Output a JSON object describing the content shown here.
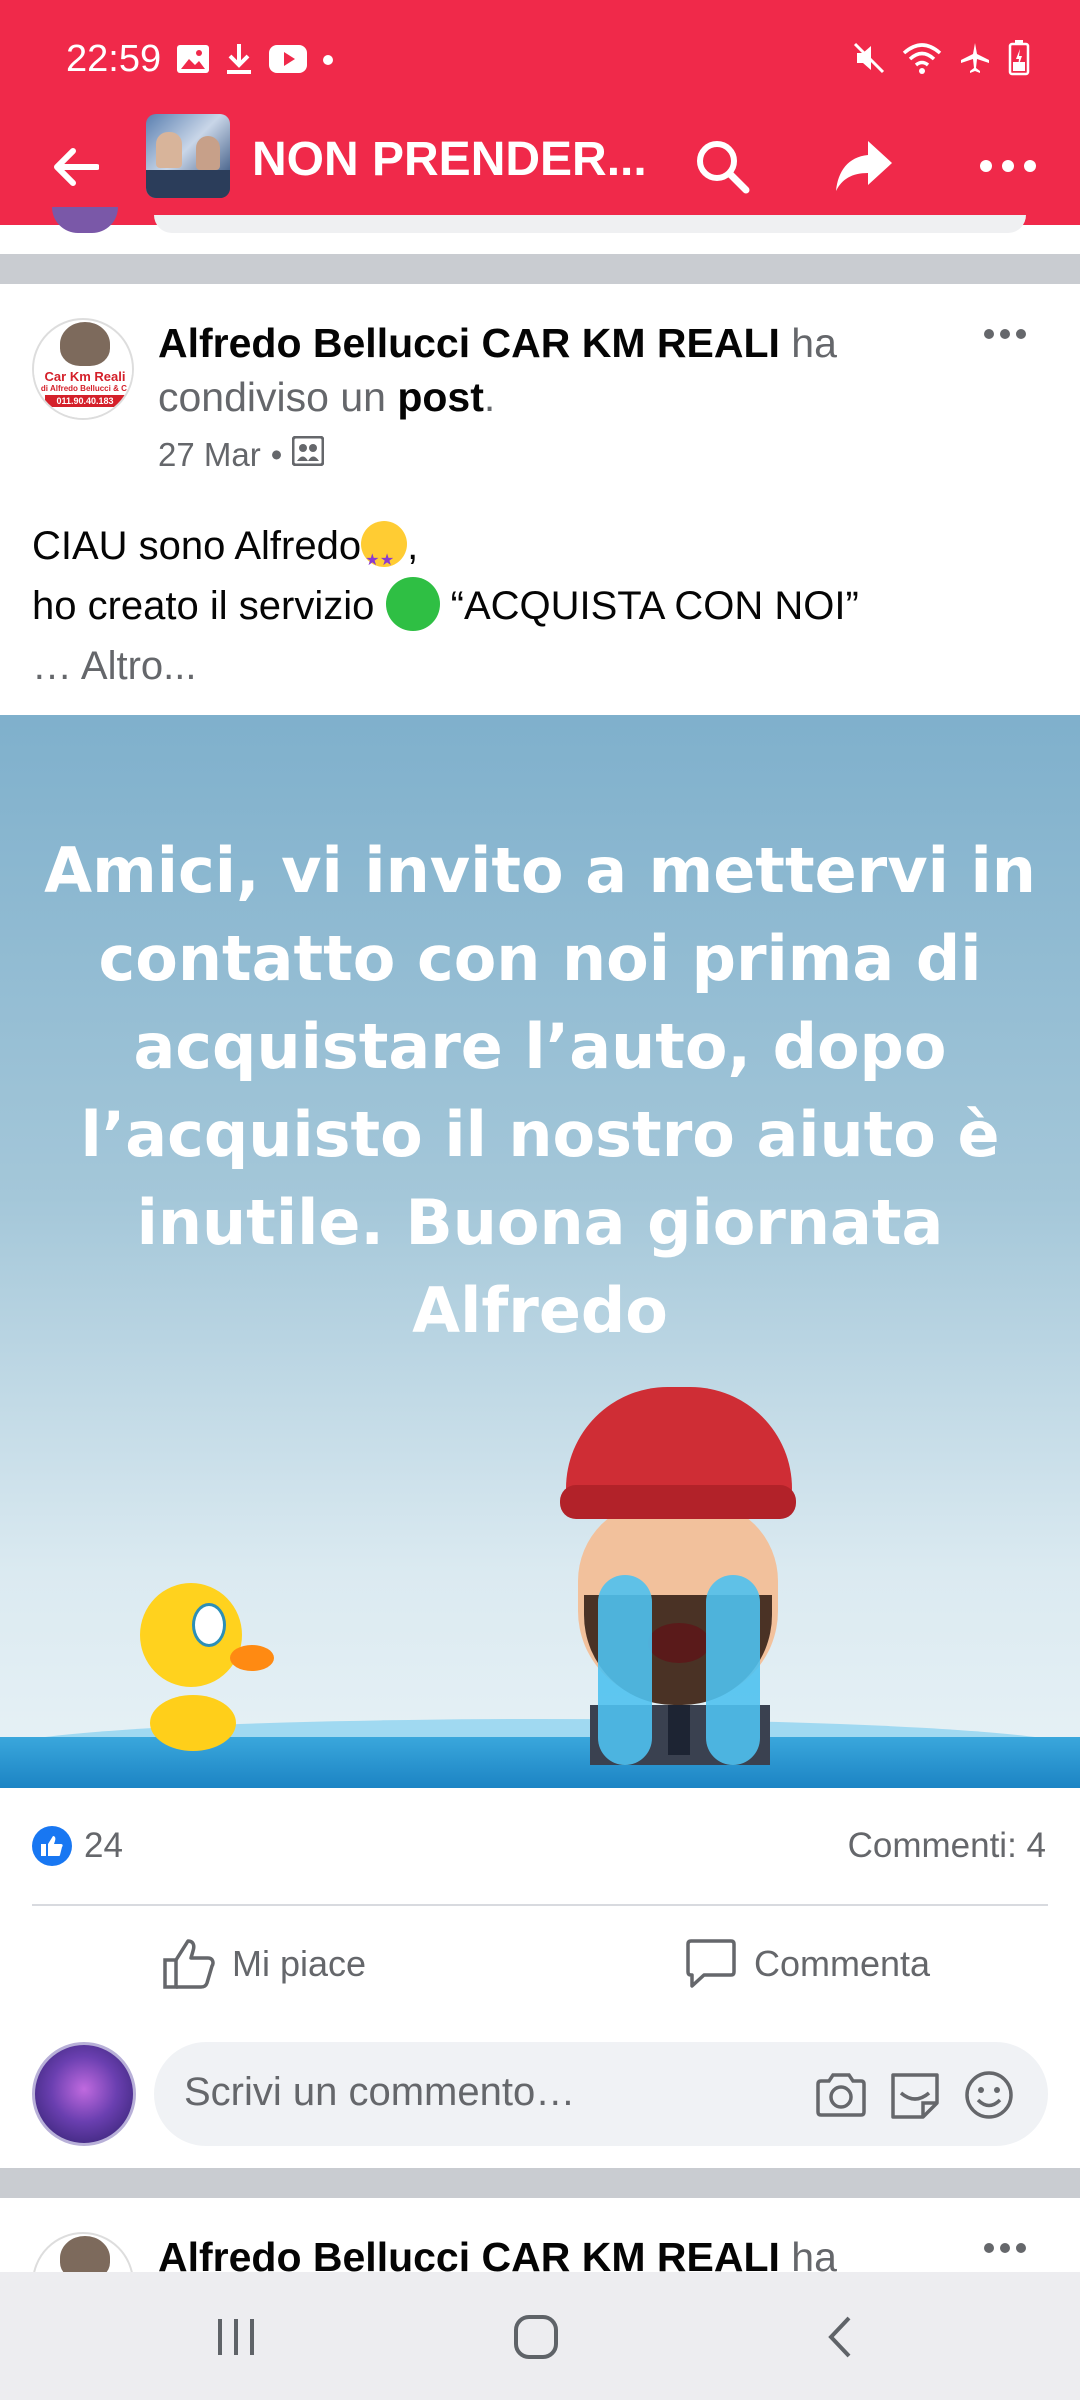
{
  "status_bar": {
    "time": "22:59"
  },
  "app_bar": {
    "title": "NON PRENDER..."
  },
  "post": {
    "author": "Alfredo Bellucci CAR KM REALI",
    "action_text": "ha condiviso un",
    "action_object": "post",
    "action_end": ".",
    "date": "27 Mar",
    "meta_sep": "•",
    "avatar_logo": {
      "line1": "Car Km Reali",
      "line2": "di Alfredo Bellucci & C.",
      "line3": "011.90.40.183"
    },
    "text_line1": "CIAU sono Alfredo",
    "text_line1_end": ",",
    "text_line2_start": "ho creato il servizio",
    "text_line2_end": "“ACQUISTA CON NOI”",
    "text_line3": "… Altro...",
    "image_text": "Amici, vi invito a mettervi in contatto con noi prima di acquistare l’auto, dopo l’acquisto il nostro aiuto è inutile. Buona giornata Alfredo",
    "like_count": "24",
    "comments": "Commenti: 4",
    "like_label": "Mi piace",
    "comment_label": "Commenta",
    "comment_placeholder": "Scrivi un commento…"
  },
  "next_post": {
    "author": "Alfredo Bellucci CAR KM REALI",
    "action_text": "ha"
  },
  "colors": {
    "brand": "#f0294a",
    "like_blue": "#1877f2",
    "muted_text": "#65676b",
    "divider": "#c9ccd1"
  }
}
